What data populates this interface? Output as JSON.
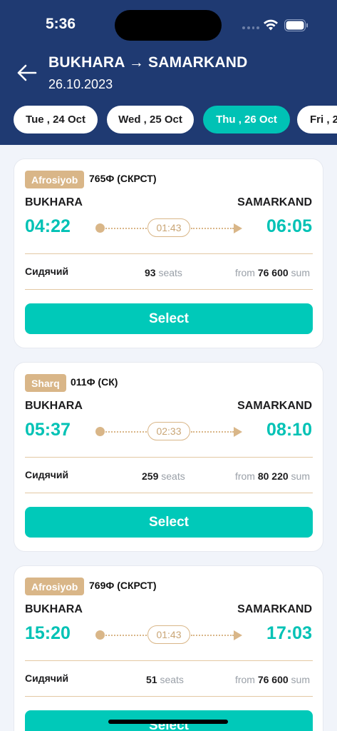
{
  "status": {
    "time": "5:36"
  },
  "header": {
    "route": "BUKHARA → SAMARKAND",
    "date": "26.10.2023"
  },
  "date_tabs": [
    {
      "label": "Tue , 24 Oct",
      "active": false
    },
    {
      "label": "Wed , 25 Oct",
      "active": false
    },
    {
      "label": "Thu , 26 Oct",
      "active": true
    },
    {
      "label": "Fri , 2",
      "active": false
    }
  ],
  "trains": [
    {
      "brand": "Afrosiyob",
      "code": "765Ф (СКРСТ)",
      "from": "BUKHARA",
      "to": "SAMARKAND",
      "departure": "04:22",
      "arrival": "06:05",
      "duration": "01:43",
      "class": "Сидячий",
      "seats_count": "93",
      "seats_label": "seats",
      "price_prefix": "from",
      "price": "76 600",
      "currency": "sum",
      "select_label": "Select"
    },
    {
      "brand": "Sharq",
      "code": "011Ф (СК)",
      "from": "BUKHARA",
      "to": "SAMARKAND",
      "departure": "05:37",
      "arrival": "08:10",
      "duration": "02:33",
      "class": "Сидячий",
      "seats_count": "259",
      "seats_label": "seats",
      "price_prefix": "from",
      "price": "80 220",
      "currency": "sum",
      "select_label": "Select"
    },
    {
      "brand": "Afrosiyob",
      "code": "769Ф (СКРСТ)",
      "from": "BUKHARA",
      "to": "SAMARKAND",
      "departure": "15:20",
      "arrival": "17:03",
      "duration": "01:43",
      "class": "Сидячий",
      "seats_count": "51",
      "seats_label": "seats",
      "price_prefix": "from",
      "price": "76 600",
      "currency": "sum",
      "select_label": "Select"
    }
  ],
  "colors": {
    "header_bg": "#1f3a72",
    "accent": "#00c2b5",
    "badge": "#d9b688"
  }
}
